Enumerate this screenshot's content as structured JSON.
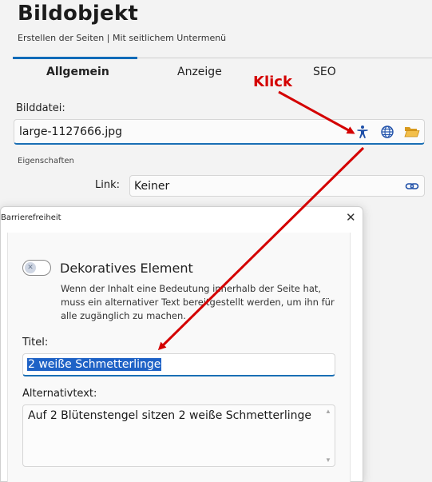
{
  "header": {
    "title": "Bildobjekt",
    "subtitle": "Erstellen der Seiten | Mit seitlichem Untermenü"
  },
  "tabs": [
    {
      "label": "Allgemein",
      "active": true
    },
    {
      "label": "Anzeige",
      "active": false
    },
    {
      "label": "SEO",
      "active": false
    }
  ],
  "form": {
    "file_label": "Bilddatei:",
    "file_value": "large-1127666.jpg",
    "section_label": "Eigenschaften",
    "link_label": "Link:",
    "link_value": "Keiner"
  },
  "annotation": {
    "label": "Klick",
    "color": "#d40000"
  },
  "dialog": {
    "title": "Barrierefreiheit",
    "close_label": "✕",
    "toggle_label": "Dekoratives Element",
    "toggle_on": false,
    "help_text": "Wenn der Inhalt eine Bedeutung innerhalb der Seite hat, muss ein alternativer Text bereitgestellt werden, um ihn für alle zugänglich zu machen.",
    "titel_label": "Titel:",
    "titel_value": "2 weiße Schmetterlinge",
    "alt_label": "Alternativtext:",
    "alt_value": "Auf 2 Blütenstengel sitzen 2 weiße Schmetterlinge"
  },
  "icons": {
    "accessibility": "accessibility-icon",
    "globe": "globe-icon",
    "folder": "folder-open-icon",
    "link": "link-icon",
    "toggle_x": "✕"
  },
  "colors": {
    "accent": "#1a6fb5",
    "selection": "#1e62c6",
    "annotation": "#d40000"
  }
}
